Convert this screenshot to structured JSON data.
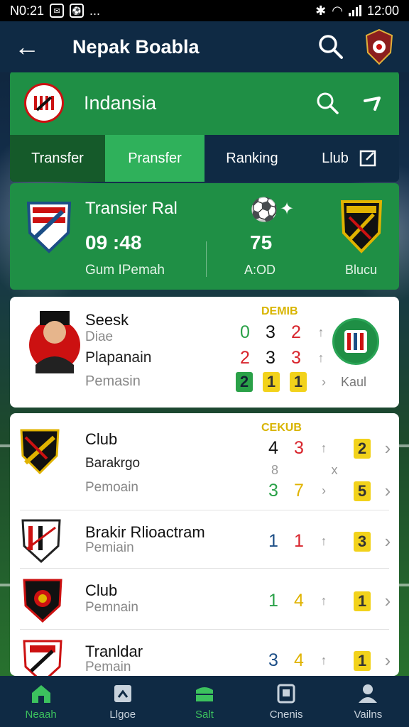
{
  "status_bar": {
    "time_left": "N0:21",
    "time_right": "12:00",
    "dots": "..."
  },
  "app_bar": {
    "back": "←",
    "title": "Nepak Boabla"
  },
  "league": {
    "name": "Indansia"
  },
  "tabs": [
    "Transfer",
    "Pransfer",
    "Ranking",
    "Llub"
  ],
  "summary": {
    "title": "Transier Ral",
    "value_left": "09 :48",
    "label_left": "Gum IPemah",
    "value_mid": "75",
    "label_mid": "A:OD",
    "label_right": "Blucu"
  },
  "card1": {
    "header": "DEMIB",
    "name": "Seesk",
    "sub": "Diae",
    "line2": "Plapanain",
    "line3": "Pemasin",
    "right_label": "Kaul",
    "row1": [
      "0",
      "3",
      "2"
    ],
    "row2": [
      "2",
      "3",
      "3"
    ],
    "row3": [
      "2",
      "1",
      "1"
    ]
  },
  "card2": {
    "header": "CEKUB",
    "top_name": "Club",
    "top_line2": "Barakrgo",
    "top_line3": "Pemoain",
    "top_row1": [
      "4",
      "3",
      "2"
    ],
    "top_row_mid": [
      "8",
      "x"
    ],
    "top_row2": [
      "3",
      "7",
      "5"
    ],
    "rows": [
      {
        "name": "Brakir Rlioactram",
        "sub": "Pemiain",
        "nums": [
          "1",
          "1",
          "3"
        ]
      },
      {
        "name": "Club",
        "sub": "Pemnain",
        "nums": [
          "1",
          "4",
          "1"
        ]
      },
      {
        "name": "Tranldar",
        "sub": "Pemain",
        "nums": [
          "3",
          "4",
          "1"
        ]
      }
    ]
  },
  "bottom_nav": [
    "Neaah",
    "Llgoe",
    "Salt",
    "Cnenis",
    "Vailns"
  ],
  "colors": {
    "green": "#1f8f45",
    "navy": "#0f2a44",
    "accent": "#3cc25e"
  }
}
